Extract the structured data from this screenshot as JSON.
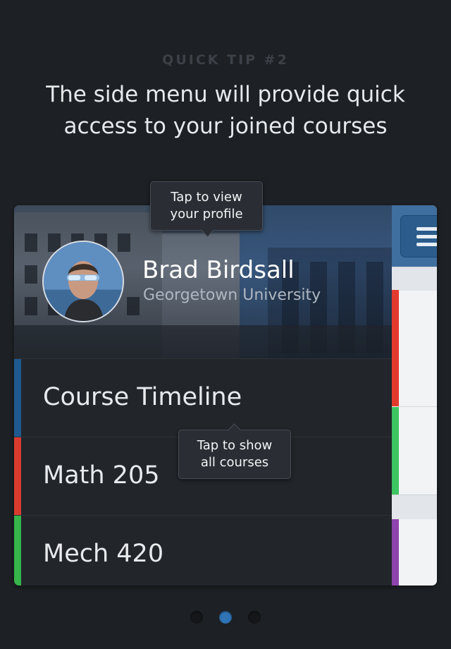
{
  "tip": {
    "kicker": "QUICK TIP #2",
    "headline_line1": "The side menu will provide quick",
    "headline_line2": "access to your joined courses"
  },
  "profile": {
    "name": "Brad Birdsall",
    "school": "Georgetown University"
  },
  "menu": {
    "items": [
      {
        "label": "Course Timeline",
        "color": "#1e5a8f"
      },
      {
        "label": "Math 205",
        "color": "#d93b2f"
      },
      {
        "label": "Mech 420",
        "color": "#35b54a"
      }
    ]
  },
  "tooltips": {
    "profile_line1": "Tap to view",
    "profile_line2": "your profile",
    "courses_line1": "Tap to show",
    "courses_line2": "all courses"
  },
  "strip_colors": [
    "#e23b2e",
    "#3cc561",
    "#8e44ad"
  ],
  "pager": {
    "current_page": 2,
    "total_pages": 3
  },
  "icons": {
    "menu": "hamburger-icon"
  }
}
